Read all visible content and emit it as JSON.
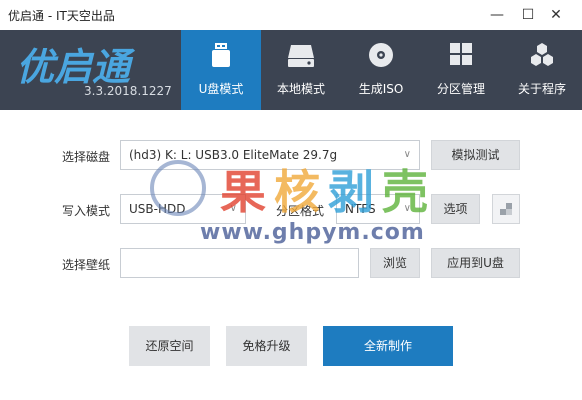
{
  "window": {
    "title": "优启通 - IT天空出品"
  },
  "header": {
    "logo": "优启通",
    "version": "3.3.2018.1227",
    "tabs": [
      {
        "label": "U盘模式",
        "icon": "usb-drive-icon"
      },
      {
        "label": "本地模式",
        "icon": "hard-disk-icon"
      },
      {
        "label": "生成ISO",
        "icon": "disc-icon"
      },
      {
        "label": "分区管理",
        "icon": "partition-grid-icon"
      },
      {
        "label": "关于程序",
        "icon": "hexagon-cluster-icon"
      }
    ]
  },
  "form": {
    "disk_label": "选择磁盘",
    "disk_value": "(hd3) K: L: USB3.0 EliteMate 29.7g",
    "simulate_btn": "模拟测试",
    "write_label": "写入模式",
    "write_value": "USB-HDD",
    "partition_label": "分区格式",
    "partition_value": "NTFS",
    "options_btn": "选项",
    "wallpaper_label": "选择壁纸",
    "wallpaper_value": "",
    "browse_btn": "浏览",
    "apply_btn": "应用到U盘"
  },
  "actions": {
    "restore": "还原空间",
    "upgrade": "免格升级",
    "create": "全新制作"
  },
  "watermark": {
    "text": "果核剥壳",
    "url": "www.ghpym.com"
  },
  "colors": {
    "accent": "#1e7cc0",
    "header_bg": "#3c4452",
    "logo": "#4aa6e0"
  }
}
